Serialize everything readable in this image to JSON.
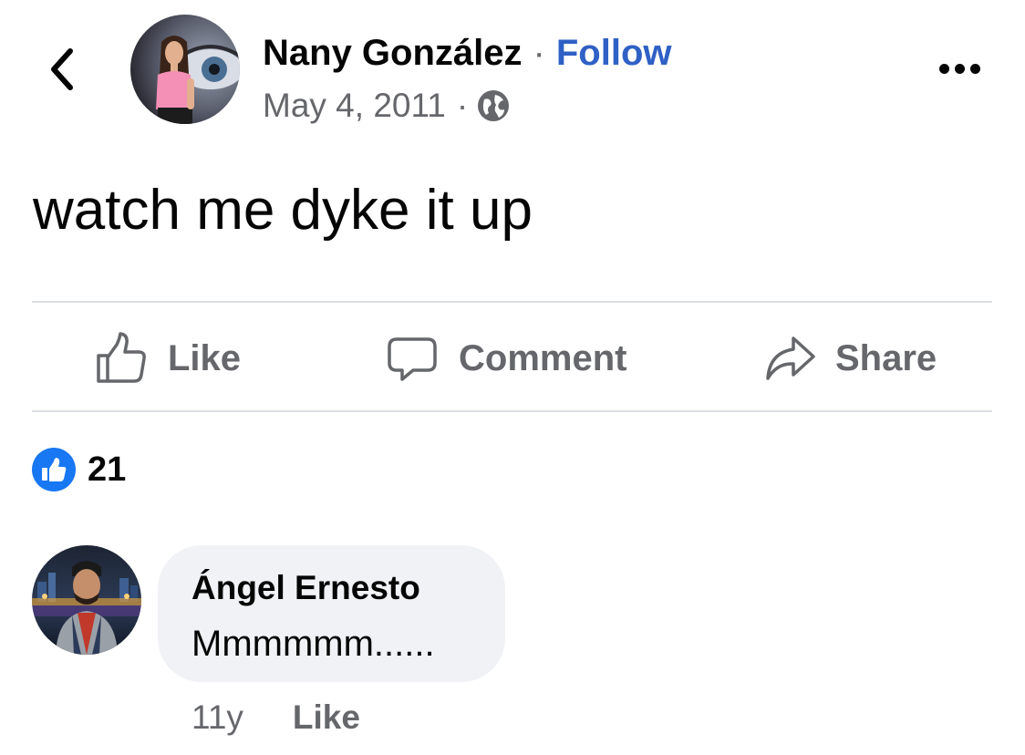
{
  "post": {
    "author_name": "Nany González",
    "separator": "·",
    "follow_label": "Follow",
    "date": "May 4, 2011",
    "meta_separator": "·",
    "audience_icon": "globe-icon",
    "text": "watch me dyke it up"
  },
  "actions": {
    "like_label": "Like",
    "comment_label": "Comment",
    "share_label": "Share"
  },
  "reactions": {
    "icon": "thumbs-up-icon",
    "count": "21"
  },
  "comment": {
    "author": "Ángel Ernesto",
    "text": "Mmmmmm......",
    "age": "11y",
    "like_label": "Like"
  },
  "colors": {
    "follow": "#2f60c5",
    "secondary_text": "#65676b",
    "like_badge": "#1877f2",
    "bubble": "#f0f2f5",
    "divider": "#dadde1"
  }
}
